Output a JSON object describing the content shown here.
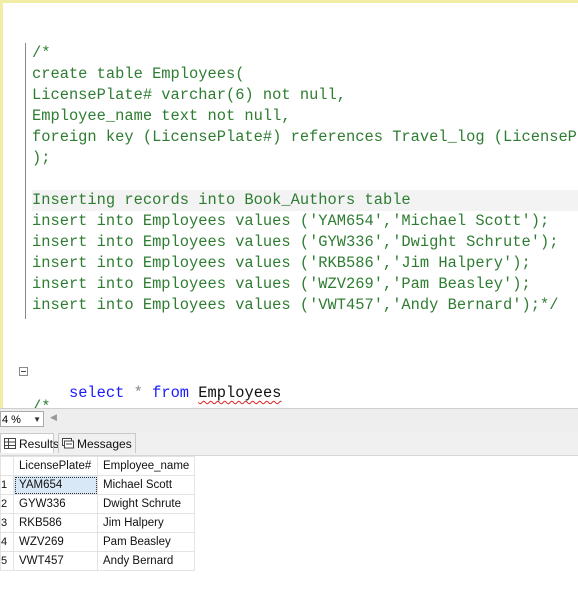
{
  "editor": {
    "lines": [
      {
        "segments": [
          {
            "text": "/*",
            "cls": ""
          }
        ]
      },
      {
        "segments": [
          {
            "text": "create table Employees(",
            "cls": ""
          }
        ]
      },
      {
        "segments": [
          {
            "text": "LicensePlate# varchar(6) not null,",
            "cls": ""
          }
        ]
      },
      {
        "segments": [
          {
            "text": "Employee_name text not null,",
            "cls": ""
          }
        ]
      },
      {
        "segments": [
          {
            "text": "foreign key (LicensePlate#) references Travel_log (LicensePlate#)",
            "cls": ""
          }
        ]
      },
      {
        "segments": [
          {
            "text": ");",
            "cls": ""
          }
        ]
      },
      {
        "segments": [
          {
            "text": "",
            "cls": ""
          }
        ]
      },
      {
        "segments": [
          {
            "text": "Inserting records into Book_Authors table",
            "cls": ""
          }
        ],
        "highlight": true
      },
      {
        "segments": [
          {
            "text": "insert into Employees values ('YAM654','Michael Scott');",
            "cls": ""
          }
        ]
      },
      {
        "segments": [
          {
            "text": "insert into Employees values ('GYW336','Dwight Schrute');",
            "cls": ""
          }
        ]
      },
      {
        "segments": [
          {
            "text": "insert into Employees values ('RKB586','Jim Halpery');",
            "cls": ""
          }
        ]
      },
      {
        "segments": [
          {
            "text": "insert into Employees values ('WZV269','Pam Beasley');",
            "cls": ""
          }
        ]
      },
      {
        "segments": [
          {
            "text": "insert into Employees values ('VWT457','Andy Bernard');*/",
            "cls": ""
          }
        ]
      }
    ],
    "select_line": {
      "kw1": "select",
      "star": " * ",
      "kw2": "from",
      "space": " ",
      "table": "Employees"
    },
    "tail_comment": "/*"
  },
  "statusbar": {
    "zoom": "4 %"
  },
  "tabs": {
    "results": "Results",
    "messages": "Messages"
  },
  "grid": {
    "columns": [
      "LicensePlate#",
      "Employee_name"
    ],
    "rows": [
      {
        "rn": "1",
        "plate": "YAM654",
        "name": "Michael Scott"
      },
      {
        "rn": "2",
        "plate": "GYW336",
        "name": "Dwight Schrute"
      },
      {
        "rn": "3",
        "plate": "RKB586",
        "name": "Jim Halpery"
      },
      {
        "rn": "4",
        "plate": "WZV269",
        "name": "Pam Beasley"
      },
      {
        "rn": "5",
        "plate": "VWT457",
        "name": "Andy Bernard"
      }
    ]
  }
}
